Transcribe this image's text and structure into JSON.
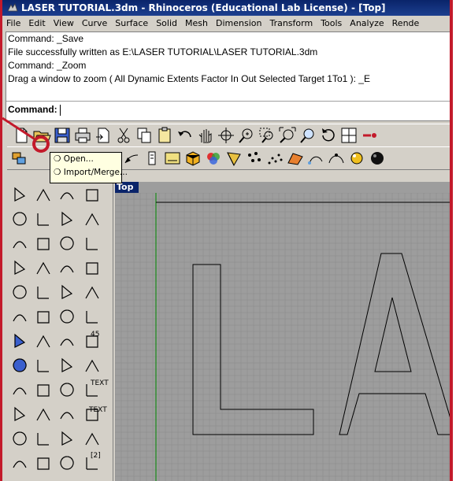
{
  "window": {
    "title": "LASER TUTORIAL.3dm - Rhinoceros (Educational Lab License) - [Top]"
  },
  "menu": [
    "File",
    "Edit",
    "View",
    "Curve",
    "Surface",
    "Solid",
    "Mesh",
    "Dimension",
    "Transform",
    "Tools",
    "Analyze",
    "Rende"
  ],
  "command_history": [
    "Command: _Save",
    "File successfully written as E:\\LASER TUTORIAL\\LASER TUTORIAL.3dm",
    "Command: _Zoom",
    "Drag a window to zoom ( All  Dynamic  Extents  Factor  In  Out  Selected  Target  1To1 ): _E"
  ],
  "command_prompt": "Command:",
  "flyout": {
    "items": [
      "Open...",
      "Import/Merge..."
    ]
  },
  "viewport": {
    "title": "Top"
  },
  "palette": {
    "text_tool_1": "TEXT",
    "text_tool_2": "TEXT",
    "badge_45": "45",
    "badge_2": "[2]"
  },
  "colors": {
    "frame": "#c31a2b",
    "titlebar": "#0a246a",
    "viewport_bg": "#9d9d9d",
    "grid": "#8a8a8a",
    "axis_green": "#1a8a1a",
    "annotation": "#c31a2b"
  },
  "icons": {
    "toolbar_row1": [
      "new-file-icon",
      "open-folder-icon",
      "save-icon",
      "print-icon",
      "import-icon",
      "cut-icon",
      "copy-icon",
      "paste-icon",
      "undo-icon",
      "pan-hand-icon",
      "rotate-view-icon",
      "zoom-dynamic-icon",
      "zoom-window-icon",
      "zoom-extents-icon",
      "zoom-selected-icon",
      "undo-view-icon",
      "viewport-layout-icon"
    ],
    "toolbar_row2": [
      "layers-icon",
      "object-props-icon",
      "select-icon",
      "shaded-icon",
      "render-icon",
      "material-icon",
      "light-icon",
      "point-icon",
      "scatter-icon",
      "mesh-icon",
      "surface-icon",
      "sphere-icon"
    ]
  }
}
